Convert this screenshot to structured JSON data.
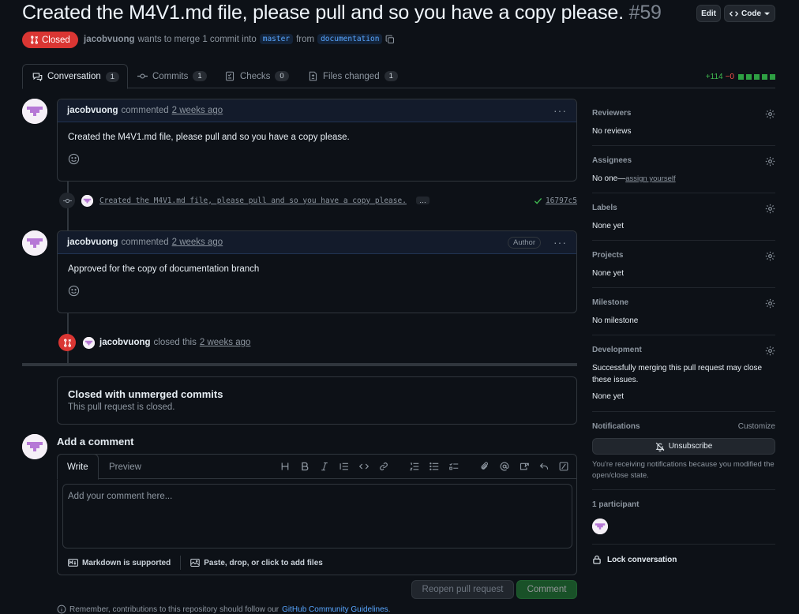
{
  "pr": {
    "title": "Created the M4V1.md file, please pull and so you have a copy please.",
    "number": "#59",
    "state": "Closed",
    "author": "jacobvuong",
    "merge_text": "wants to merge 1 commit into",
    "base_branch": "master",
    "from_text": "from",
    "head_branch": "documentation",
    "edit_label": "Edit",
    "code_label": "Code"
  },
  "tabs": [
    {
      "label": "Conversation",
      "count": "1"
    },
    {
      "label": "Commits",
      "count": "1"
    },
    {
      "label": "Checks",
      "count": "0"
    },
    {
      "label": "Files changed",
      "count": "1"
    }
  ],
  "diffstat": {
    "additions": "+114",
    "deletions": "−0"
  },
  "timeline": {
    "comment1": {
      "author": "jacobvuong",
      "action": "commented",
      "time": "2 weeks ago",
      "body": "Created the M4V1.md file, please pull and so you have a copy please."
    },
    "commit": {
      "message": "Created the M4V1.md file, please pull and so you have a copy please.",
      "more": "…",
      "sha": "16797c5"
    },
    "comment2": {
      "author": "jacobvuong",
      "action": "commented",
      "time": "2 weeks ago",
      "role": "Author",
      "body": "Approved for the copy of documentation branch"
    },
    "closed_event": {
      "author": "jacobvuong",
      "action": "closed this",
      "time": "2 weeks ago"
    },
    "closed_box": {
      "title": "Closed with unmerged commits",
      "subtitle": "This pull request is closed."
    }
  },
  "form": {
    "title": "Add a comment",
    "write_tab": "Write",
    "preview_tab": "Preview",
    "placeholder": "Add your comment here...",
    "markdown_note": "Markdown is supported",
    "attach_note": "Paste, drop, or click to add files",
    "reopen_label": "Reopen pull request",
    "comment_label": "Comment",
    "guidelines_prefix": "Remember, contributions to this repository should follow our",
    "guidelines_link": "GitHub Community Guidelines",
    "guidelines_suffix": "."
  },
  "sidebar": {
    "reviewers": {
      "label": "Reviewers",
      "value": "No reviews"
    },
    "assignees": {
      "label": "Assignees",
      "value_prefix": "No one—",
      "value_link": "assign yourself"
    },
    "labels": {
      "label": "Labels",
      "value": "None yet"
    },
    "projects": {
      "label": "Projects",
      "value": "None yet"
    },
    "milestone": {
      "label": "Milestone",
      "value": "No milestone"
    },
    "development": {
      "label": "Development",
      "note": "Successfully merging this pull request may close these issues.",
      "value": "None yet"
    },
    "notifications": {
      "label": "Notifications",
      "customize": "Customize",
      "button": "Unsubscribe",
      "note": "You're receiving notifications because you modified the open/close state."
    },
    "participants": {
      "label": "1 participant"
    },
    "lock": {
      "label": "Lock conversation"
    }
  },
  "colors": {
    "closed": "#da3633",
    "link": "#58a6ff",
    "addition": "#3fb950",
    "deletion": "#f85149",
    "comment_button": "#238636"
  }
}
